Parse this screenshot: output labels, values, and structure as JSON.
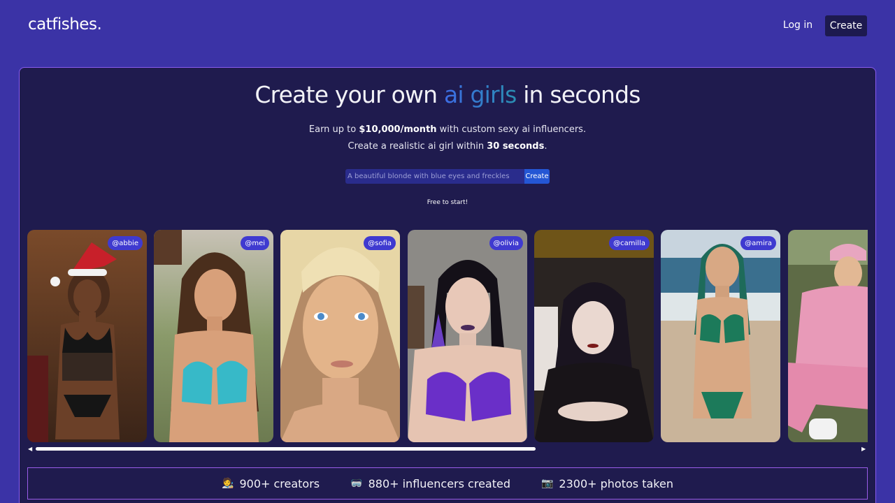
{
  "header": {
    "logo": "catfishes.",
    "login_label": "Log in",
    "create_label": "Create"
  },
  "hero": {
    "title_before": "Create your own ",
    "title_highlight": "ai girls",
    "title_after": " in seconds",
    "line1_before": "Earn up to ",
    "line1_bold": "$10,000/month",
    "line1_after": " with custom sexy ai influencers.",
    "line2_before": "Create a realistic ai girl within ",
    "line2_bold": "30 seconds",
    "line2_after": ".",
    "prompt_placeholder": "A beautiful blonde with blue eyes and freckles",
    "prompt_button": "Create",
    "free_note": "Free to start!"
  },
  "gallery": {
    "cards": [
      {
        "handle": "@abbie"
      },
      {
        "handle": "@mei"
      },
      {
        "handle": "@sofia"
      },
      {
        "handle": "@olivia"
      },
      {
        "handle": "@camilla"
      },
      {
        "handle": "@amira"
      },
      {
        "handle": ""
      }
    ],
    "scroll_left": "◀",
    "scroll_right": "▶"
  },
  "stats": [
    {
      "icon": "🧑‍🎨",
      "label": "900+ creators"
    },
    {
      "icon": "🥽",
      "label": "880+ influencers created"
    },
    {
      "icon": "📷",
      "label": "2300+ photos taken"
    }
  ],
  "colors": {
    "background": "#3b33a6",
    "panel": "#1f1b4e",
    "panel_border": "#8a5cf0",
    "accent_blue": "#2456d4",
    "handle_pill": "#3f3ad0"
  }
}
